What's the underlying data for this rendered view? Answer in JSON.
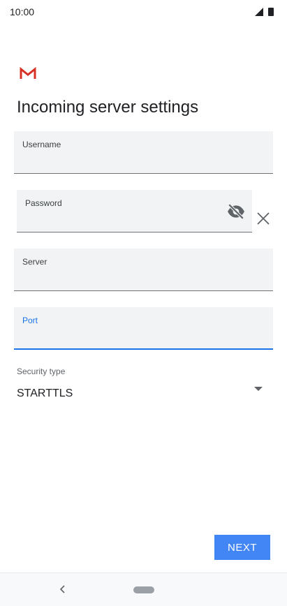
{
  "status_bar": {
    "time": "10:00",
    "signal_icon": "signal-icon",
    "battery_icon": "battery-icon"
  },
  "app": {
    "logo_icon": "gmail-logo-icon"
  },
  "page": {
    "title": "Incoming server settings"
  },
  "form": {
    "username": {
      "label": "Username",
      "value": ""
    },
    "password": {
      "label": "Password",
      "value": "",
      "toggle_icon": "visibility-off-icon"
    },
    "clear_icon": "close-icon",
    "server": {
      "label": "Server",
      "value": ""
    },
    "port": {
      "label": "Port",
      "value": ""
    },
    "security_type": {
      "label": "Security type",
      "value": "STARTTLS"
    }
  },
  "actions": {
    "next_label": "NEXT"
  },
  "navigation": {
    "back_icon": "back-chevron-icon",
    "home_icon": "home-pill-icon"
  },
  "colors": {
    "accent": "#1a73e8",
    "button": "#4285f4",
    "field_background": "#f1f3f4",
    "gmail_red": "#d93025"
  }
}
